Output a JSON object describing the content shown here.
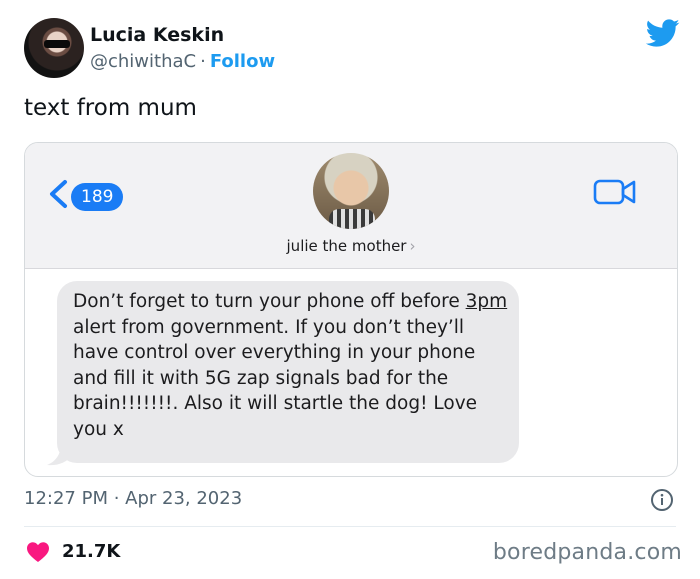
{
  "author": {
    "name": "Lucia Keskin",
    "handle": "@chiwithaC",
    "separator": "·",
    "follow_label": "Follow"
  },
  "tweet": {
    "text": "text from mum",
    "timestamp": "12:27 PM · Apr 23, 2023",
    "likes": "21.7K"
  },
  "imessage": {
    "back_count": "189",
    "contact_name": "julie the mother",
    "contact_chevron": "›",
    "message": {
      "pre": "Don’t forget to turn your phone off before ",
      "underlined": "3pm",
      "post": " alert from government. If you don’t they’ll have control over everything in your phone and fill it with 5G zap signals bad for the brain!!!!!!!. Also it will startle the dog! Love you x"
    }
  },
  "watermark": "boredpanda.com",
  "icons": {
    "brand": "twitter-bird-icon",
    "back": "chevron-left-icon",
    "video": "video-camera-icon",
    "info": "info-icon",
    "like": "heart-icon"
  },
  "colors": {
    "twitter_blue": "#1d9bf0",
    "imessage_blue": "#1a7cf5",
    "heart": "#f91880",
    "bubble": "#e9e9eb"
  }
}
